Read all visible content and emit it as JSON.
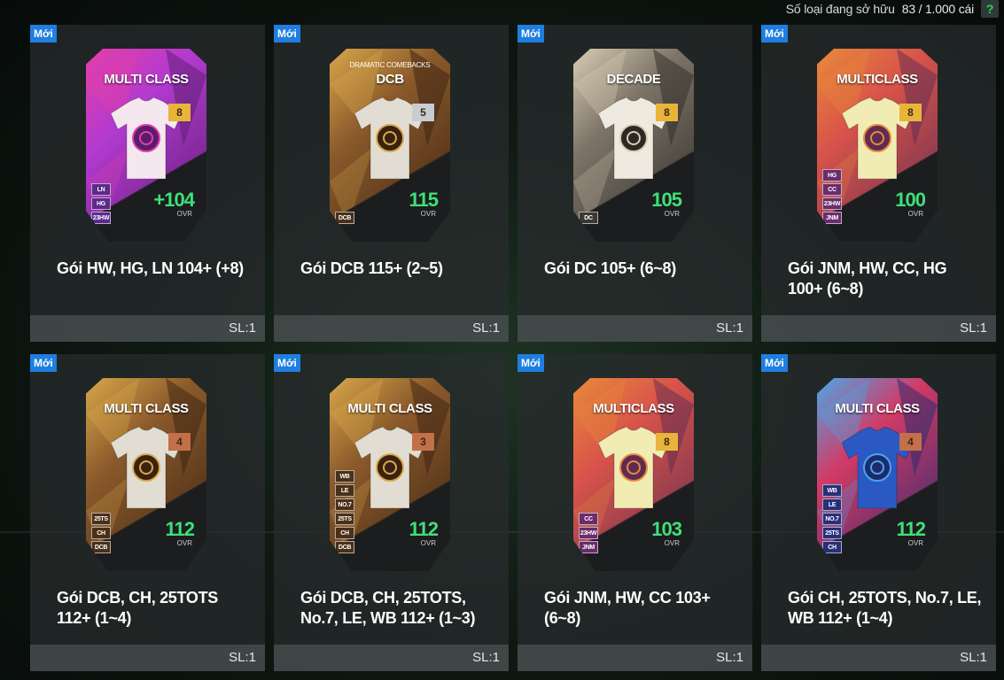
{
  "header": {
    "owned_label": "Số loại đang sở hữu",
    "owned_count": "83 / 1.000 cái",
    "help_icon": "?"
  },
  "packs": [
    {
      "badge": "Mới",
      "name": "Gói HW, HG, LN 104+ (+8)",
      "qty": "SL:1",
      "card": {
        "title": "MULTI CLASS",
        "subtitle": "",
        "grade": "8",
        "ovr": "104",
        "ovr_prefix": "+",
        "ovr_label": "OVR",
        "chips": [
          "LN",
          "HG",
          "23HW"
        ]
      },
      "colors": {
        "bg1": "#b23ad0",
        "bg2": "#5a1d6e",
        "accent": "#e53fa7",
        "jersey": "#f5e7ee",
        "grade_bg": "#e8b43a",
        "chip_bg": "#5b2a8a"
      }
    },
    {
      "badge": "Mới",
      "name": "Gói DCB 115+ (2~5)",
      "qty": "SL:1",
      "card": {
        "title": "DCB",
        "subtitle": "DRAMATIC COMEBACKS",
        "grade": "5",
        "ovr": "115",
        "ovr_prefix": "",
        "ovr_label": "OVR",
        "chips": [
          "DCB"
        ]
      },
      "colors": {
        "bg1": "#8b5a2b",
        "bg2": "#3a2212",
        "accent": "#d9a84a",
        "jersey": "#e2ddd2",
        "grade_bg": "#c9cdd2",
        "chip_bg": "#4a3018"
      }
    },
    {
      "badge": "Mới",
      "name": "Gói DC 105+ (6~8)",
      "qty": "SL:1",
      "card": {
        "title": "DECADE",
        "subtitle": "",
        "grade": "8",
        "ovr": "105",
        "ovr_prefix": "",
        "ovr_label": "OVR",
        "chips": [
          "DC"
        ]
      },
      "colors": {
        "bg1": "#7d7468",
        "bg2": "#2c2925",
        "accent": "#d8ccb3",
        "jersey": "#eeeae0",
        "grade_bg": "#e8b43a",
        "chip_bg": "#3a3734"
      }
    },
    {
      "badge": "Mới",
      "name": "Gói JNM, HW, CC, HG 100+ (6~8)",
      "qty": "SL:1",
      "card": {
        "title": "MULTICLASS",
        "subtitle": "",
        "grade": "8",
        "ovr": "100",
        "ovr_prefix": "",
        "ovr_label": "OVR",
        "chips": [
          "HG",
          "CC",
          "23HW",
          "JNM"
        ]
      },
      "colors": {
        "bg1": "#d8534a",
        "bg2": "#5e2b52",
        "accent": "#e98a3a",
        "jersey": "#f1ecb3",
        "grade_bg": "#e8b43a",
        "chip_bg": "#6b2c6c"
      }
    },
    {
      "badge": "Mới",
      "name": "Gói DCB, CH, 25TOTS 112+ (1~4)",
      "qty": "SL:1",
      "card": {
        "title": "MULTI CLASS",
        "subtitle": "",
        "grade": "4",
        "ovr": "112",
        "ovr_prefix": "",
        "ovr_label": "OVR",
        "chips": [
          "25TS",
          "CH",
          "DCB"
        ]
      },
      "colors": {
        "bg1": "#8b5a2b",
        "bg2": "#3a2212",
        "accent": "#d9a84a",
        "jersey": "#e2ddd2",
        "grade_bg": "#c2704a",
        "chip_bg": "#4a3018"
      }
    },
    {
      "badge": "Mới",
      "name": "Gói DCB, CH, 25TOTS, No.7, LE, WB 112+ (1~3)",
      "qty": "SL:1",
      "card": {
        "title": "MULTI CLASS",
        "subtitle": "",
        "grade": "3",
        "ovr": "112",
        "ovr_prefix": "",
        "ovr_label": "OVR",
        "chips": [
          "WB",
          "LE",
          "NO.7",
          "25TS",
          "CH",
          "DCB"
        ]
      },
      "colors": {
        "bg1": "#8b5a2b",
        "bg2": "#3a2212",
        "accent": "#d9a84a",
        "jersey": "#e2ddd2",
        "grade_bg": "#c2704a",
        "chip_bg": "#4a3018"
      }
    },
    {
      "badge": "Mới",
      "name": "Gói JNM, HW, CC 103+ (6~8)",
      "qty": "SL:1",
      "card": {
        "title": "MULTICLASS",
        "subtitle": "",
        "grade": "8",
        "ovr": "103",
        "ovr_prefix": "",
        "ovr_label": "OVR",
        "chips": [
          "CC",
          "23HW",
          "JNM"
        ]
      },
      "colors": {
        "bg1": "#d8534a",
        "bg2": "#5e2b52",
        "accent": "#e98a3a",
        "jersey": "#f1ecb3",
        "grade_bg": "#e8b43a",
        "chip_bg": "#6b2c6c"
      }
    },
    {
      "badge": "Mới",
      "name": "Gói CH, 25TOTS, No.7, LE, WB 112+ (1~4)",
      "qty": "SL:1",
      "card": {
        "title": "MULTI CLASS",
        "subtitle": "",
        "grade": "4",
        "ovr": "112",
        "ovr_prefix": "",
        "ovr_label": "OVR",
        "chips": [
          "WB",
          "LE",
          "NO.7",
          "25TS",
          "CH"
        ]
      },
      "colors": {
        "bg1": "#d23a66",
        "bg2": "#1f2a6e",
        "accent": "#4aa7e8",
        "jersey": "#2a59c4",
        "grade_bg": "#c2704a",
        "chip_bg": "#2a2f7a"
      }
    }
  ]
}
